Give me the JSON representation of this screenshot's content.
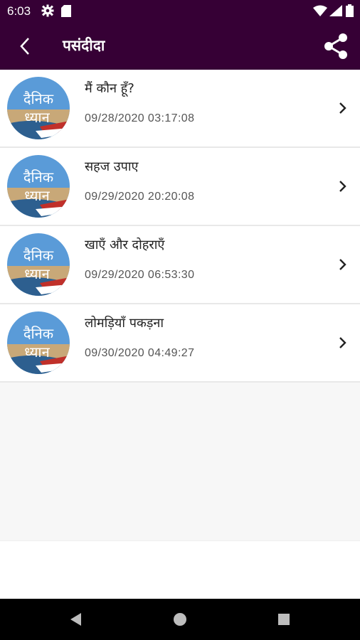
{
  "status": {
    "time": "6:03"
  },
  "appbar": {
    "title": "पसंदीदा"
  },
  "thumb_text": {
    "line1": "दैनिक",
    "line2": "ध्यान"
  },
  "items": [
    {
      "title": "मैं कौन हूँ?",
      "date": "09/28/2020 03:17:08"
    },
    {
      "title": "सहज उपाए",
      "date": "09/29/2020 20:20:08"
    },
    {
      "title": "खाएँ और दोहराएँ",
      "date": "09/29/2020 06:53:30"
    },
    {
      "title": "लोमड़ियाँ पकड़ना",
      "date": "09/30/2020 04:49:27"
    }
  ],
  "colors": {
    "appbar": "#360035",
    "background": "#f7f7f7"
  }
}
